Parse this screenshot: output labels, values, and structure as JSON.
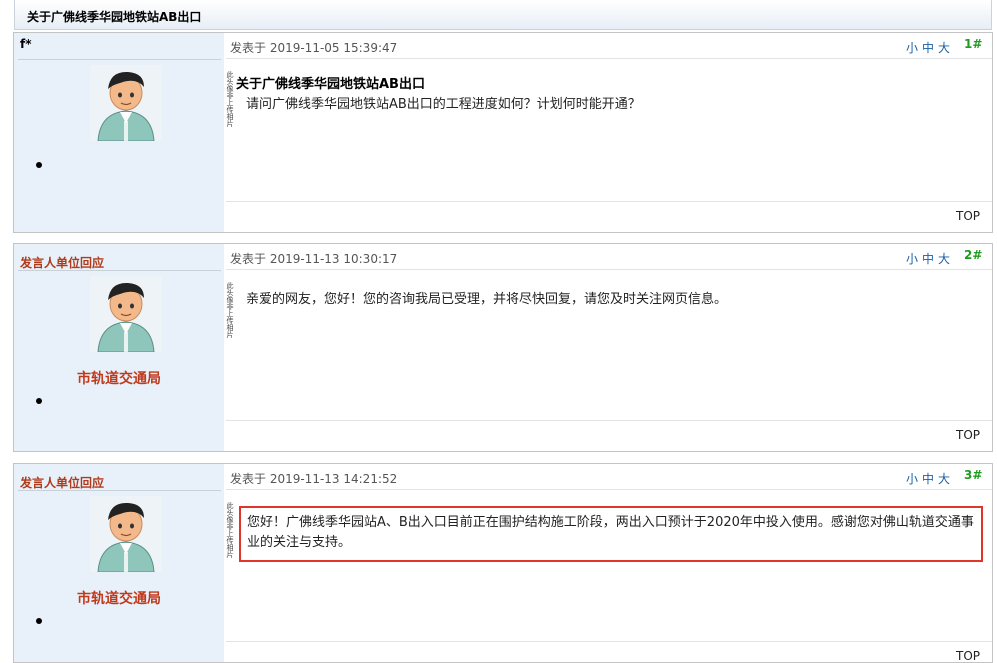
{
  "thread": {
    "title": "关于广佛线季华园地铁站AB出口"
  },
  "avatar": {
    "caption": "此头像非上传相片"
  },
  "posts": [
    {
      "author": "f*",
      "unit": "",
      "timestamp": "发表于 2019-11-05 15:39:47",
      "floor": "1#",
      "subject": "关于广佛线季华园地铁站AB出口",
      "body": "请问广佛线季华园地铁站AB出口的工程进度如何？计划何时能开通？",
      "top": "TOP"
    },
    {
      "author": "发言人单位回应",
      "unit": "市轨道交通局",
      "timestamp": "发表于 2019-11-13 10:30:17",
      "floor": "2#",
      "body": "亲爱的网友，您好！您的咨询我局已受理，并将尽快回复，请您及时关注网页信息。",
      "top": "TOP"
    },
    {
      "author": "发言人单位回应",
      "unit": "市轨道交通局",
      "timestamp": "发表于 2019-11-13 14:21:52",
      "floor": "3#",
      "body": "您好！广佛线季华园站A、B出入口目前正在围护结构施工阶段，两出入口预计于2020年中投入使用。感谢您对佛山轨道交通事业的关注与支持。",
      "top": "TOP"
    }
  ],
  "font_controls": {
    "small": "小",
    "medium": "中",
    "large": "大"
  },
  "colors": {
    "author_red": "#b03a1a",
    "floor_green": "#1e9c1e",
    "link_blue": "#1a5fa8",
    "highlight_red": "#e0352b",
    "sidebar_bg": "#e8f1fa"
  }
}
